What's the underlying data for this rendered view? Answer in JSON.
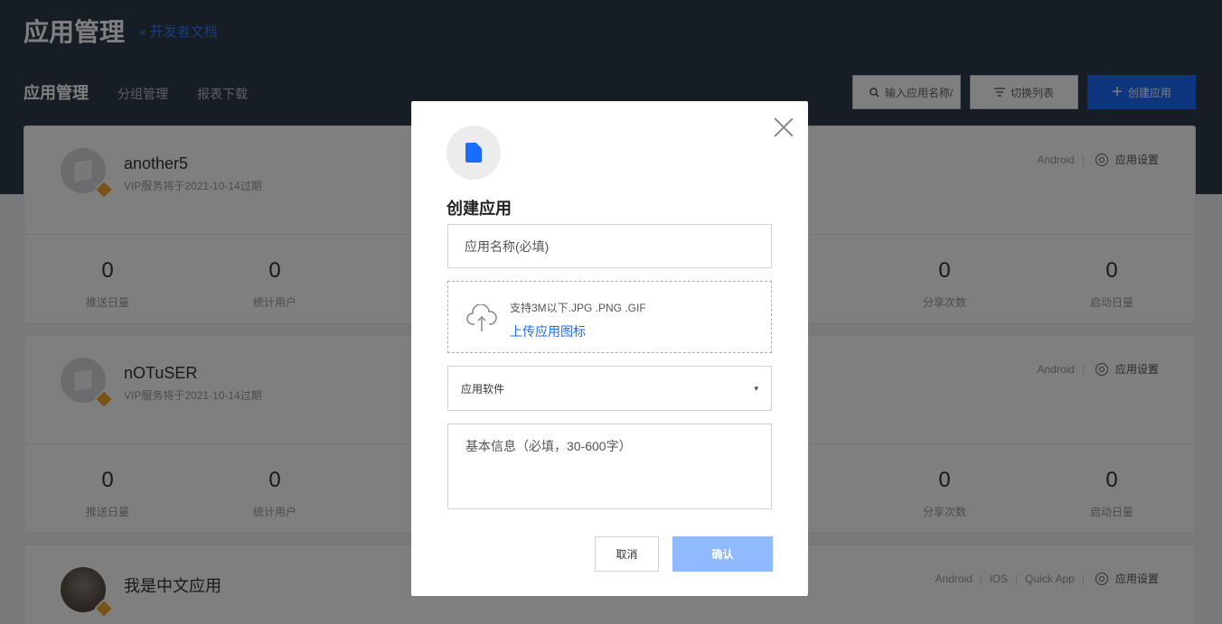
{
  "header": {
    "title": "应用管理",
    "dev_doc_icon": "≡",
    "dev_doc": "开发者文档"
  },
  "nav": {
    "items": [
      {
        "label": "应用管理"
      },
      {
        "label": "分组管理"
      },
      {
        "label": "报表下载"
      }
    ]
  },
  "toolbar": {
    "search_placeholder": "输入应用名称/",
    "switch_list": "切换列表",
    "create": "创建应用"
  },
  "apps": [
    {
      "name": "another5",
      "vip": "VIP服务将于2021-10-14过期",
      "platforms": [
        "Android"
      ],
      "settings": "应用设置",
      "stats": [
        {
          "value": "0",
          "label": "推送日量"
        },
        {
          "value": "0",
          "label": "统计用户"
        },
        {
          "value": "0",
          "label": "分享次数"
        },
        {
          "value": "0",
          "label": "启动日量"
        }
      ]
    },
    {
      "name": "nOTuSER",
      "vip": "VIP服务将于2021-10-14过期",
      "platforms": [
        "Android"
      ],
      "settings": "应用设置",
      "stats": [
        {
          "value": "0",
          "label": "推送日量"
        },
        {
          "value": "0",
          "label": "统计用户"
        },
        {
          "value": "0",
          "label": "分享次数"
        },
        {
          "value": "0",
          "label": "启动日量"
        }
      ]
    },
    {
      "name": "我是中文应用",
      "platforms": [
        "Android",
        "iOS",
        "Quick App"
      ],
      "settings": "应用设置"
    }
  ],
  "modal": {
    "title": "创建应用",
    "name_placeholder": "应用名称(必填)",
    "upload_hint": "支持3M以下.JPG .PNG .GIF",
    "upload_link": "上传应用图标",
    "category_selected": "应用软件",
    "info_placeholder": "基本信息（必填，30-600字）",
    "cancel": "取消",
    "confirm": "确认"
  },
  "colors": {
    "primary": "#1a6cff",
    "confirm_disabled": "#8fbaff",
    "header_bg": "#2f3a4a"
  }
}
